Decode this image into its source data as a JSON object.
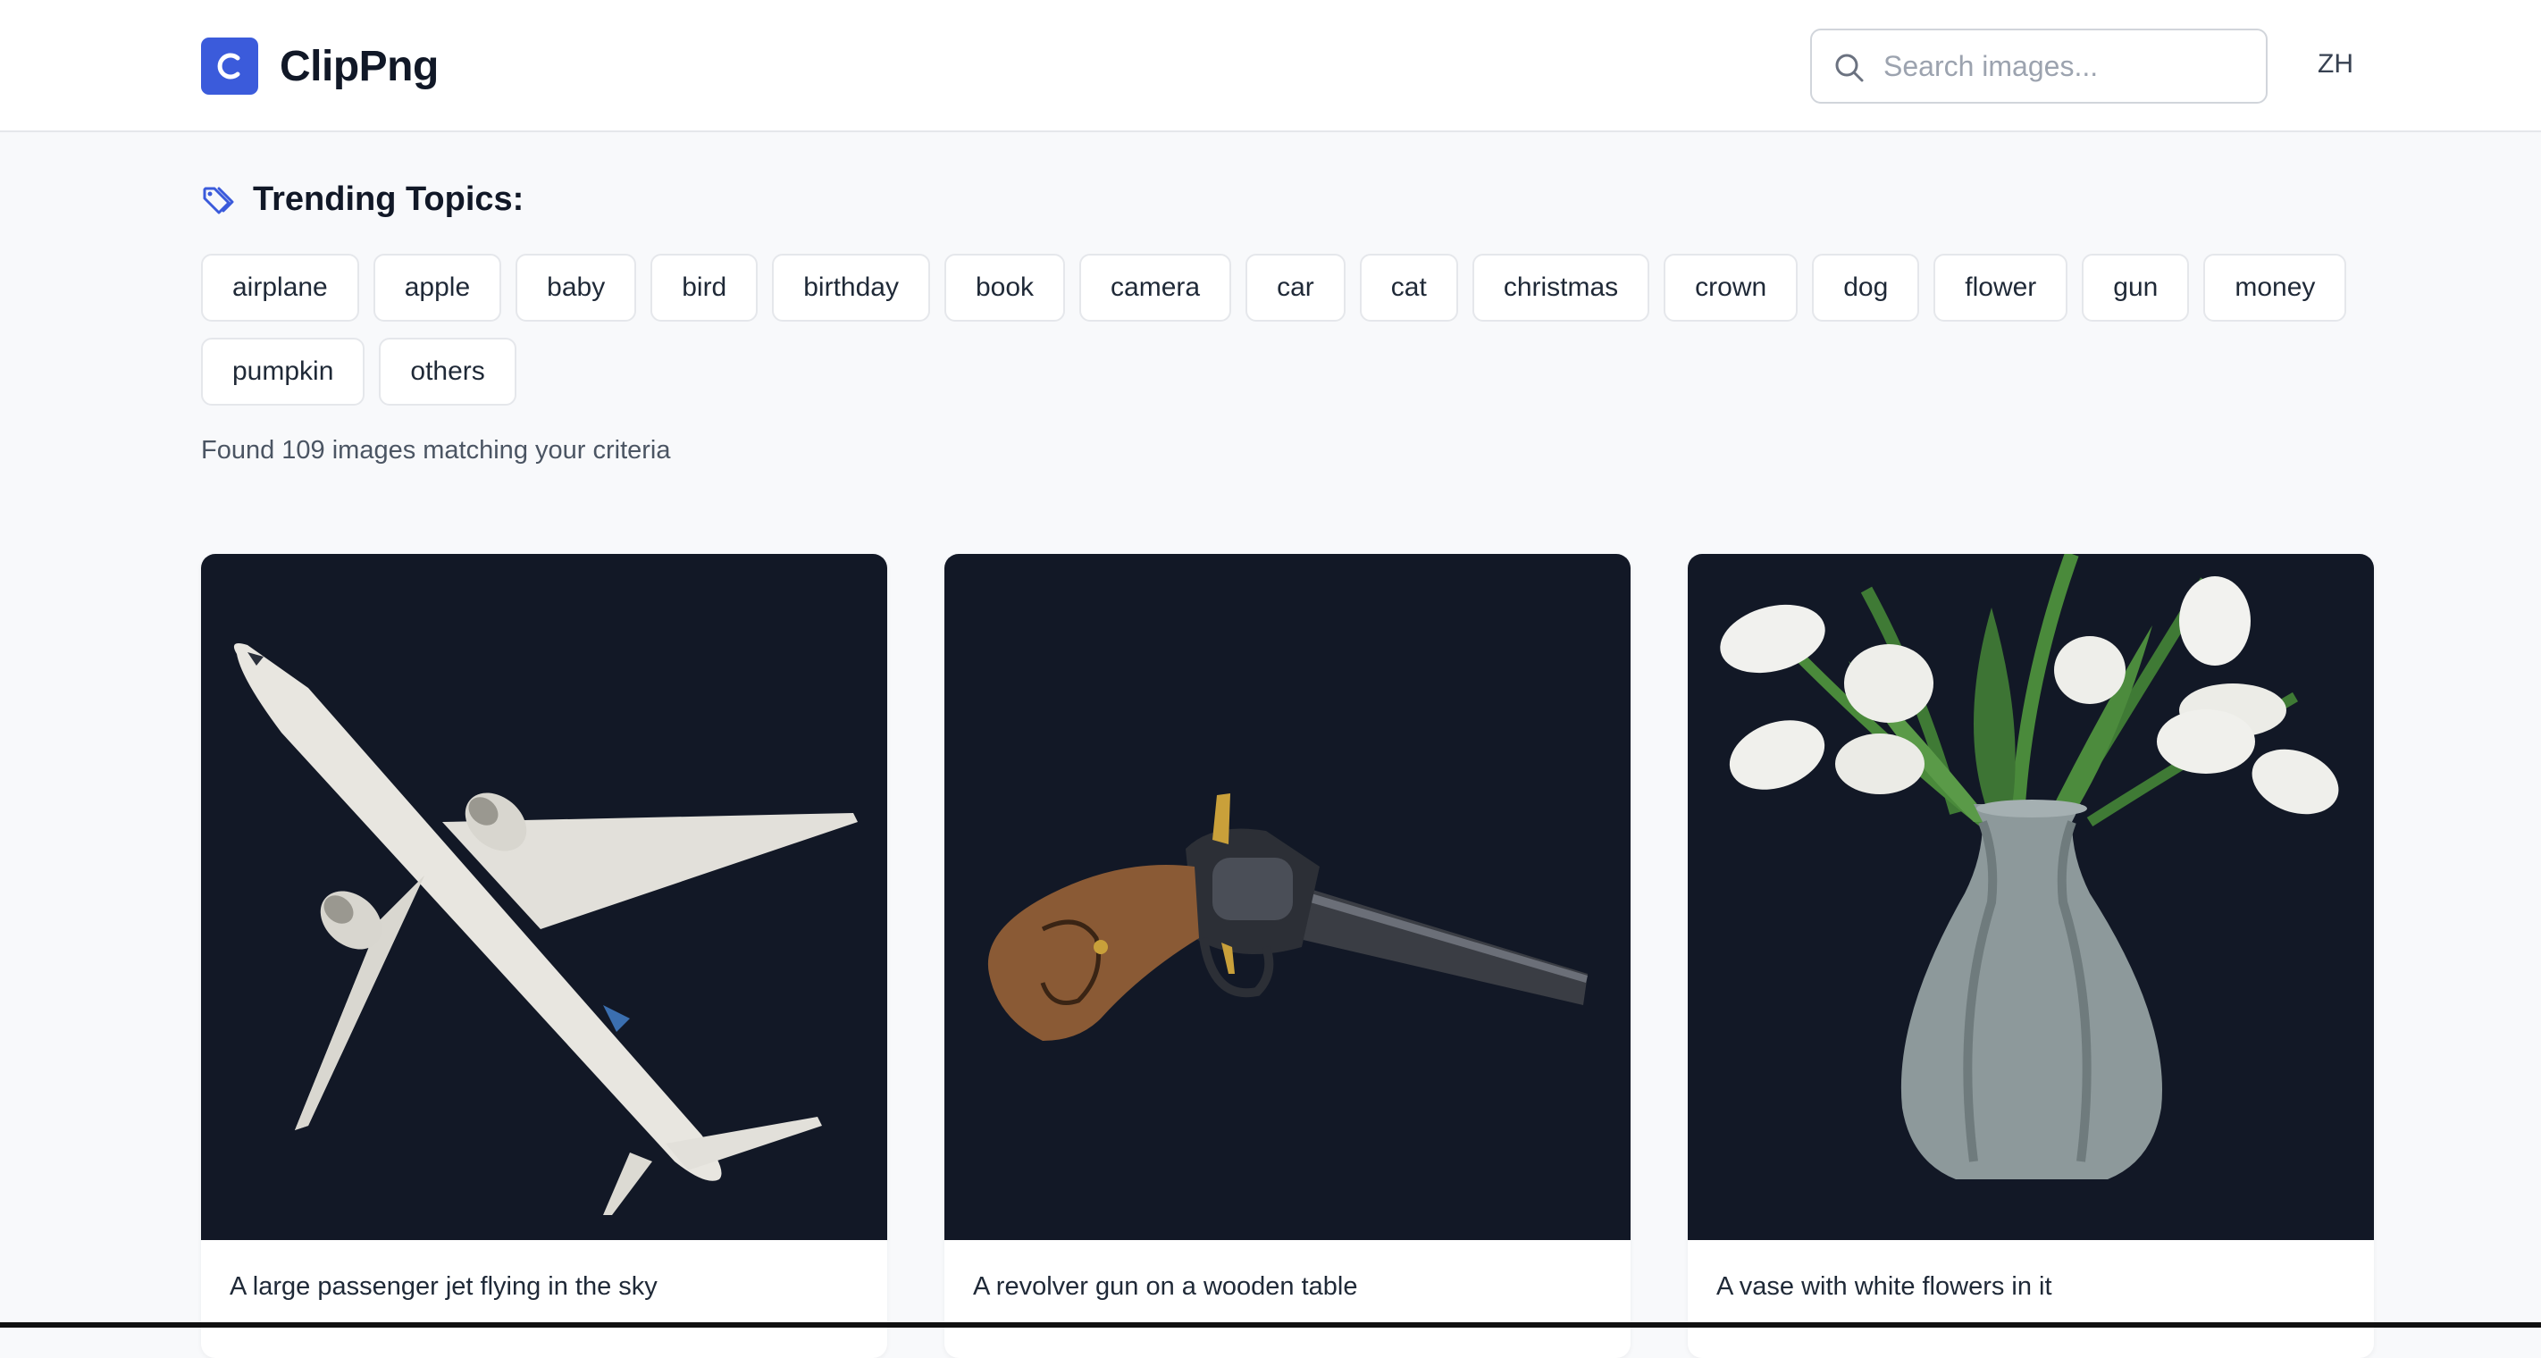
{
  "app": {
    "name": "ClipPng",
    "logo_letter": "C",
    "brand_color": "#3b5bdb"
  },
  "header": {
    "search_placeholder": "Search images...",
    "search_value": "",
    "lang_label": "ZH"
  },
  "trending": {
    "title": "Trending Topics:",
    "icon": "tag-icon",
    "topics": [
      "airplane",
      "apple",
      "baby",
      "bird",
      "birthday",
      "book",
      "camera",
      "car",
      "cat",
      "christmas",
      "crown",
      "dog",
      "flower",
      "gun",
      "money",
      "pumpkin",
      "others"
    ]
  },
  "results": {
    "summary": "Found 109 images matching your criteria",
    "cards": [
      {
        "caption": "A large passenger jet flying in the sky",
        "image": "airplane"
      },
      {
        "caption": "A revolver gun on a wooden table",
        "image": "revolver"
      },
      {
        "caption": "A vase with white flowers in it",
        "image": "tulip-vase"
      }
    ]
  }
}
